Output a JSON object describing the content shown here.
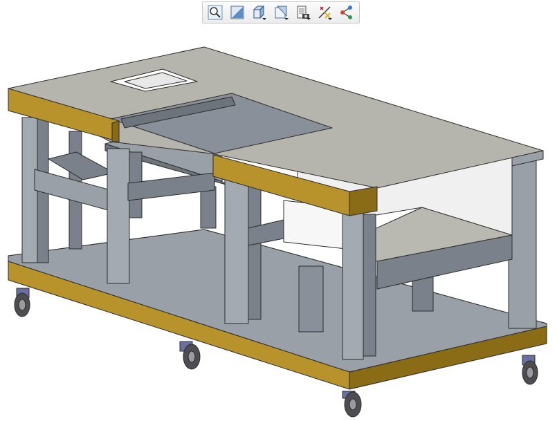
{
  "toolbar": {
    "buttons": [
      {
        "id": "zoom-to-fit",
        "icon": "magnifier-icon",
        "has_dropdown": false
      },
      {
        "id": "zoom-to-area",
        "icon": "zoom-area-icon",
        "has_dropdown": false
      },
      {
        "id": "view-orientation",
        "icon": "cube-icon",
        "has_dropdown": true
      },
      {
        "id": "display-style",
        "icon": "display-style-icon",
        "has_dropdown": true
      },
      {
        "id": "view-settings",
        "icon": "camera-settings-icon",
        "has_dropdown": true
      },
      {
        "id": "hide-show-items",
        "icon": "hide-show-icon",
        "has_dropdown": true
      },
      {
        "id": "apply-scene",
        "icon": "scene-icon",
        "has_dropdown": false
      }
    ]
  },
  "model": {
    "description_visible": false,
    "colors": {
      "top_surface": "#b5b5ad",
      "panel_gray": "#8a9099",
      "panel_dark": "#6e747c",
      "leg_light": "#a4aab2",
      "leg_dark": "#7b818a",
      "wood_edge": "#b8922a",
      "wood_edge_dark": "#8a6b16",
      "floor": "#8c929b",
      "wheel": "#6a6fa0"
    }
  }
}
